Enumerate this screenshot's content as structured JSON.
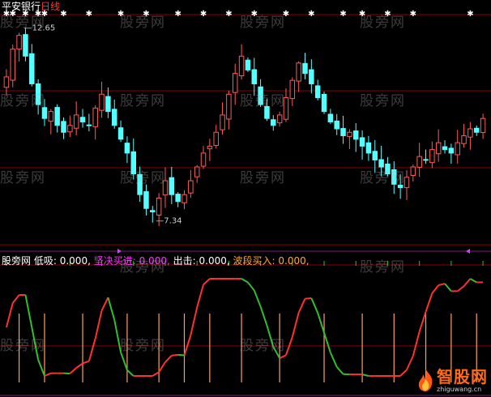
{
  "header": {
    "stock_name": "平安银行",
    "period": "日线"
  },
  "indicator_header": {
    "name": "股旁网",
    "items": [
      {
        "label": "低吸",
        "value": "0.000",
        "color": "#ffffff"
      },
      {
        "label": "坚决买进",
        "value": "0.000",
        "color": "#ff33ff"
      },
      {
        "label": "出击",
        "value": "0.000",
        "color": "#ffffff"
      },
      {
        "label": "波段买入",
        "value": "0.000",
        "color": "#ffaa33"
      }
    ]
  },
  "watermark_text": "股旁网",
  "brand": {
    "name": "智股网",
    "url": "zhiguwang.cn"
  },
  "colors": {
    "up": "#ff5a5a",
    "down": "#54ffff",
    "osc_up": "#ff3030",
    "osc_down": "#2fbf2f",
    "signal": "#ffa060",
    "marker": "#cc44ff",
    "grid": "#8b0000"
  },
  "chart_data": [
    {
      "type": "candlestick",
      "title": "平安银行 日线",
      "ylim": [
        6.6,
        13.2
      ],
      "annotations": [
        {
          "label": "12.65",
          "kind": "high"
        },
        {
          "label": "7.34",
          "kind": "low"
        }
      ],
      "close": [
        11.4,
        12.2,
        12.6,
        12.0,
        11.2,
        10.6,
        10.2,
        10.4,
        10.0,
        9.8,
        10.0,
        10.3,
        10.1,
        10.0,
        10.5,
        10.9,
        10.4,
        10.0,
        9.6,
        9.2,
        8.6,
        8.0,
        7.6,
        7.5,
        7.9,
        8.4,
        8.0,
        7.8,
        8.0,
        8.4,
        8.8,
        9.2,
        9.4,
        9.8,
        10.3,
        10.9,
        11.5,
        12.0,
        11.6,
        11.2,
        10.6,
        10.2,
        10.0,
        10.3,
        10.8,
        11.3,
        11.8,
        11.5,
        11.2,
        10.8,
        10.4,
        10.1,
        9.9,
        9.7,
        9.8,
        9.6,
        9.4,
        9.2,
        9.0,
        8.8,
        8.6,
        8.3,
        8.2,
        8.5,
        8.8,
        9.1,
        9.0,
        9.3,
        9.5,
        9.3,
        9.2,
        9.5,
        9.7,
        9.9,
        9.8,
        10.2
      ],
      "signal_days": [
        2,
        6,
        12,
        19,
        24,
        28,
        32,
        37,
        43,
        50,
        56,
        61,
        66,
        70,
        74
      ],
      "top_markers": [
        0,
        1,
        3,
        5,
        6,
        9,
        13,
        18,
        22,
        27,
        31,
        35,
        39,
        44,
        48,
        53,
        56,
        60,
        64,
        73
      ]
    },
    {
      "type": "line",
      "title": "股旁网",
      "series": [
        {
          "name": "低吸",
          "values": [
            0,
            0,
            0,
            0,
            0,
            0,
            0,
            0,
            0,
            0,
            0,
            0,
            0,
            0,
            0,
            0,
            0,
            0,
            0,
            0,
            0,
            0,
            0,
            0,
            0,
            0,
            0,
            0,
            0,
            0,
            0,
            0,
            0,
            0,
            0,
            0,
            0,
            0,
            0,
            0,
            0,
            0,
            0,
            0,
            0,
            0,
            0,
            0,
            0,
            0,
            0,
            0,
            0,
            0,
            0,
            0,
            0,
            0,
            0,
            0,
            0,
            0,
            0,
            0,
            0,
            0,
            0,
            0,
            0,
            0,
            0,
            0,
            0,
            0,
            0,
            0
          ]
        },
        {
          "name": "坚决买进",
          "values": [
            0,
            0,
            0,
            0,
            0,
            0,
            0,
            0,
            0,
            0,
            0,
            0,
            0,
            0,
            0,
            0,
            0,
            0,
            0,
            0,
            0,
            0,
            0,
            0,
            0,
            0,
            0,
            0,
            0,
            0,
            0,
            0,
            0,
            0,
            0,
            0,
            0,
            0,
            0,
            0,
            0,
            0,
            0,
            0,
            0,
            0,
            0,
            0,
            0,
            0,
            0,
            0,
            0,
            0,
            0,
            0,
            0,
            0,
            0,
            0,
            0,
            0,
            0,
            0,
            0,
            0,
            0,
            0,
            0,
            0,
            0,
            0,
            0,
            0,
            0,
            0
          ]
        },
        {
          "name": "出击",
          "values": [
            0,
            0,
            0,
            0,
            0,
            0,
            0,
            0,
            0,
            0,
            0,
            0,
            0,
            0,
            0,
            0,
            0,
            0,
            0,
            0,
            0,
            0,
            0,
            0,
            0,
            0,
            0,
            0,
            0,
            0,
            0,
            0,
            0,
            0,
            0,
            0,
            0,
            0,
            0,
            0,
            0,
            0,
            0,
            0,
            0,
            0,
            0,
            0,
            0,
            0,
            0,
            0,
            0,
            0,
            0,
            0,
            0,
            0,
            0,
            0,
            0,
            0,
            0,
            0,
            0,
            0,
            0,
            0,
            0,
            0,
            0,
            0,
            0,
            0,
            0,
            0
          ]
        },
        {
          "name": "波段买入",
          "values": [
            0,
            0,
            0,
            0,
            0,
            0,
            0,
            0,
            0,
            0,
            0,
            0,
            0,
            0,
            0,
            0,
            0,
            0,
            0,
            0,
            0,
            0,
            0,
            0,
            0,
            0,
            0,
            0,
            0,
            0,
            0,
            0,
            0,
            0,
            0,
            0,
            0,
            0,
            0,
            0,
            0,
            0,
            0,
            0,
            0,
            0,
            0,
            0,
            0,
            0,
            0,
            0,
            0,
            0,
            0,
            0,
            0,
            0,
            0,
            0,
            0,
            0,
            0,
            0,
            0,
            0,
            0,
            0,
            0,
            0,
            0,
            0,
            0,
            0,
            0,
            0
          ]
        }
      ]
    }
  ]
}
